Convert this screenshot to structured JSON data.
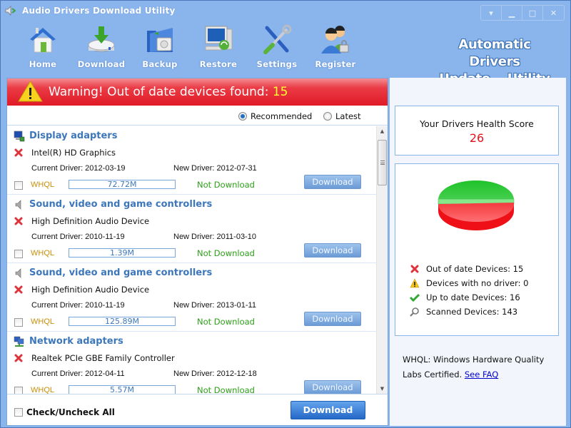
{
  "window": {
    "title": "Audio Drivers Download Utility",
    "controls": [
      {
        "name": "menu-dropdown-button",
        "icon": "menu-dropdown-icon",
        "glyph": "▾"
      },
      {
        "name": "minimize-button",
        "icon": "minimize-icon",
        "glyph": "▁"
      },
      {
        "name": "maximize-button",
        "icon": "maximize-icon",
        "glyph": "□"
      },
      {
        "name": "close-button",
        "icon": "close-icon",
        "glyph": "✕"
      }
    ]
  },
  "toolbar": {
    "items": [
      {
        "label": "Home",
        "icon": "home-icon"
      },
      {
        "label": "Download",
        "icon": "download-drive-icon"
      },
      {
        "label": "Backup",
        "icon": "backup-folder-icon"
      },
      {
        "label": "Restore",
        "icon": "restore-computer-icon"
      },
      {
        "label": "Settings",
        "icon": "settings-tools-icon"
      },
      {
        "label": "Register",
        "icon": "register-users-icon"
      }
    ]
  },
  "brand": {
    "line1": "Automatic Drivers",
    "line2": "Update Utility"
  },
  "warning": {
    "text": "Warning! Out of date devices found:",
    "count": "15",
    "icon": "warning-triangle-icon"
  },
  "filter": {
    "options": [
      {
        "label": "Recommended",
        "selected": true
      },
      {
        "label": "Latest",
        "selected": false
      }
    ]
  },
  "devices": [
    {
      "category": "Display adapters",
      "category_icon": "display-adapter-icon",
      "name": "Intel(R) HD Graphics",
      "current_driver": "Current Driver: 2012-03-19",
      "new_driver": "New Driver: 2012-07-31",
      "whql": "WHQL",
      "size": "72.72M",
      "status": "Not Download",
      "button": "Download",
      "checked": false
    },
    {
      "category": "Sound, video and game controllers",
      "category_icon": "speaker-icon",
      "name": "High Definition Audio Device",
      "current_driver": "Current Driver: 2010-11-19",
      "new_driver": "New Driver: 2011-03-10",
      "whql": "WHQL",
      "size": "1.39M",
      "status": "Not Download",
      "button": "Download",
      "checked": false
    },
    {
      "category": "Sound, video and game controllers",
      "category_icon": "speaker-icon",
      "name": "High Definition Audio Device",
      "current_driver": "Current Driver: 2010-11-19",
      "new_driver": "New Driver: 2013-01-11",
      "whql": "WHQL",
      "size": "125.89M",
      "status": "Not Download",
      "button": "Download",
      "checked": false
    },
    {
      "category": "Network adapters",
      "category_icon": "network-adapter-icon",
      "name": "Realtek PCIe GBE Family Controller",
      "current_driver": "Current Driver: 2012-04-11",
      "new_driver": "New Driver: 2012-12-18",
      "whql": "WHQL",
      "size": "5.57M",
      "status": "Not Download",
      "button": "Download",
      "checked": false
    }
  ],
  "footer": {
    "check_all_label": "Check/Uncheck All",
    "download_label": "Download"
  },
  "health": {
    "label": "Your Drivers Health Score",
    "score": "26"
  },
  "stats": {
    "pie": {
      "up_to_date": 16,
      "out_of_date": 15,
      "colors": {
        "up_to_date": "#22c22e",
        "out_of_date": "#f01e24"
      }
    },
    "items": [
      {
        "label": "Out of date Devices: 15",
        "icon": "red-x-icon"
      },
      {
        "label": "Devices with no driver: 0",
        "icon": "warning-icon"
      },
      {
        "label": "Up to date Devices: 16",
        "icon": "green-check-icon"
      },
      {
        "label": "Scanned Devices: 143",
        "icon": "magnifier-icon"
      }
    ]
  },
  "note": {
    "text": "WHQL: Windows Hardware Quality Labs Certified.",
    "link": "See FAQ"
  }
}
